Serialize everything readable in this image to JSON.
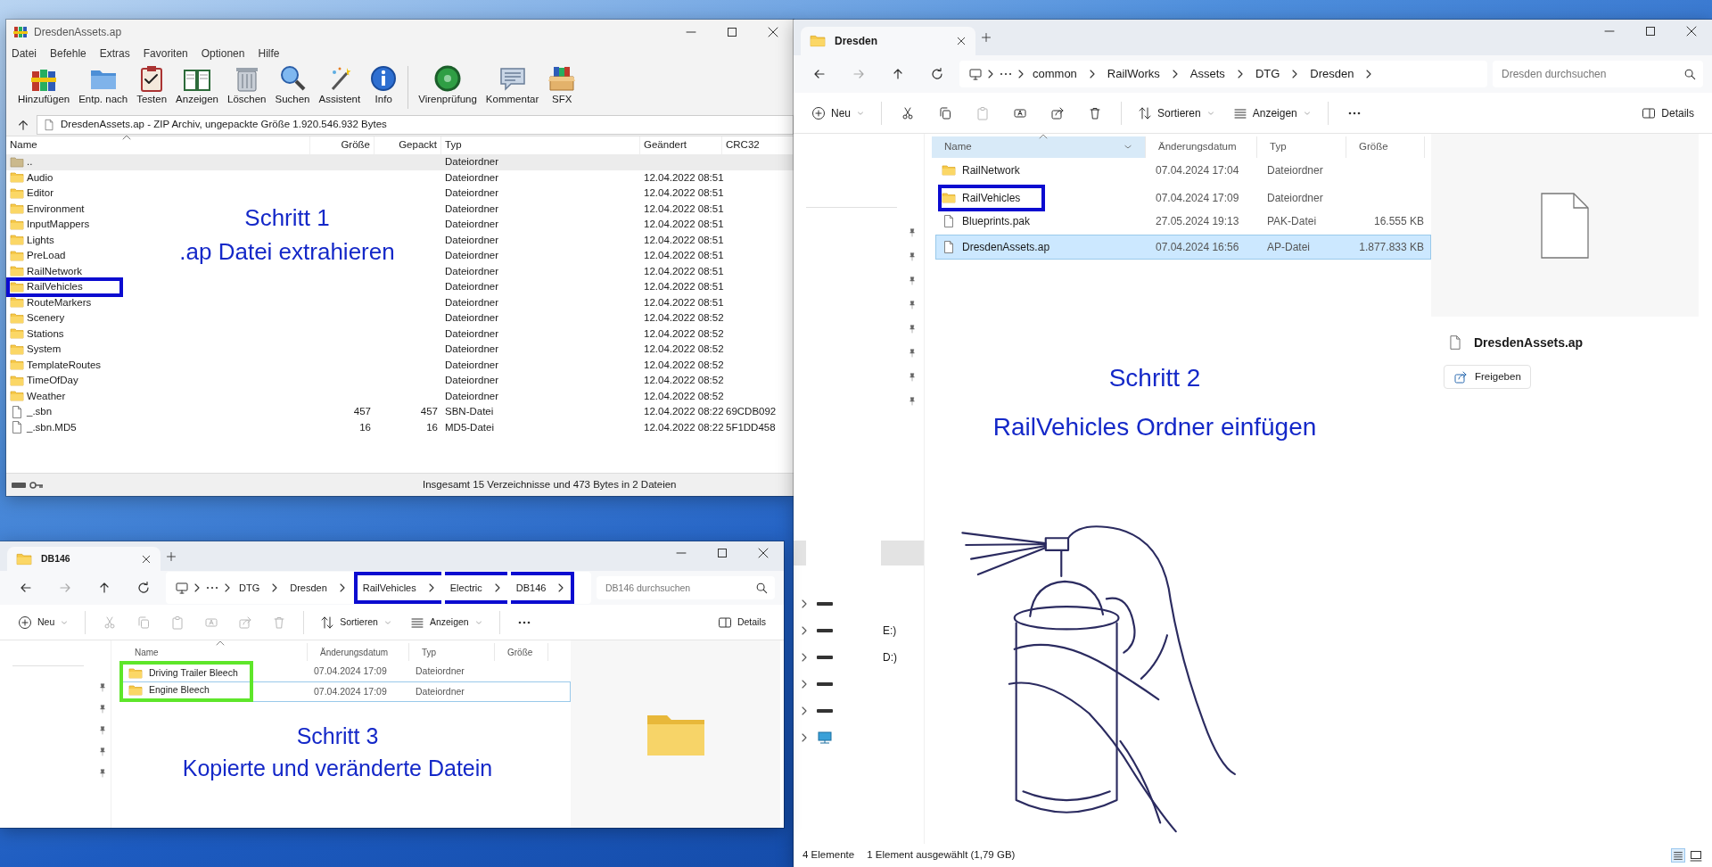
{
  "winrar": {
    "title": "DresdenAssets.ap",
    "menu": [
      "Datei",
      "Befehle",
      "Extras",
      "Favoriten",
      "Optionen",
      "Hilfe"
    ],
    "toolbar": [
      [
        {
          "label": "Hinzufügen",
          "kind": "books"
        },
        {
          "label": "Entp. nach",
          "kind": "folder"
        },
        {
          "label": "Testen",
          "kind": "clipboard"
        },
        {
          "label": "Anzeigen",
          "kind": "book"
        },
        {
          "label": "Löschen",
          "kind": "trash"
        },
        {
          "label": "Suchen",
          "kind": "magnifier"
        },
        {
          "label": "Assistent",
          "kind": "wand"
        },
        {
          "label": "Info",
          "kind": "info"
        }
      ],
      [
        {
          "label": "Virenprüfung",
          "kind": "virus"
        },
        {
          "label": "Kommentar",
          "kind": "comment"
        },
        {
          "label": "SFX",
          "kind": "box"
        }
      ]
    ],
    "path": "DresdenAssets.ap - ZIP Archiv, ungepackte Größe 1.920.546.932 Bytes",
    "columns": [
      "Name",
      "Größe",
      "Gepackt",
      "Typ",
      "Geändert",
      "CRC32"
    ],
    "rows": [
      {
        "kind": "parent",
        "name": "..",
        "type": "Dateiordner",
        "selected": true,
        "highlighted": false
      },
      {
        "kind": "folder",
        "name": "Audio",
        "type": "Dateiordner",
        "modified": "12.04.2022 08:51",
        "selected": false,
        "highlighted": false
      },
      {
        "kind": "folder",
        "name": "Editor",
        "type": "Dateiordner",
        "modified": "12.04.2022 08:51",
        "selected": false,
        "highlighted": false
      },
      {
        "kind": "folder",
        "name": "Environment",
        "type": "Dateiordner",
        "modified": "12.04.2022 08:51",
        "selected": false,
        "highlighted": false
      },
      {
        "kind": "folder",
        "name": "InputMappers",
        "type": "Dateiordner",
        "modified": "12.04.2022 08:51",
        "selected": false,
        "highlighted": false
      },
      {
        "kind": "folder",
        "name": "Lights",
        "type": "Dateiordner",
        "modified": "12.04.2022 08:51",
        "selected": false,
        "highlighted": false
      },
      {
        "kind": "folder",
        "name": "PreLoad",
        "type": "Dateiordner",
        "modified": "12.04.2022 08:51",
        "selected": false,
        "highlighted": false
      },
      {
        "kind": "folder",
        "name": "RailNetwork",
        "type": "Dateiordner",
        "modified": "12.04.2022 08:51",
        "selected": false,
        "highlighted": false
      },
      {
        "kind": "folder",
        "name": "RailVehicles",
        "type": "Dateiordner",
        "modified": "12.04.2022 08:51",
        "selected": false,
        "highlighted": true
      },
      {
        "kind": "folder",
        "name": "RouteMarkers",
        "type": "Dateiordner",
        "modified": "12.04.2022 08:51",
        "selected": false,
        "highlighted": false
      },
      {
        "kind": "folder",
        "name": "Scenery",
        "type": "Dateiordner",
        "modified": "12.04.2022 08:52",
        "selected": false,
        "highlighted": false
      },
      {
        "kind": "folder",
        "name": "Stations",
        "type": "Dateiordner",
        "modified": "12.04.2022 08:52",
        "selected": false,
        "highlighted": false
      },
      {
        "kind": "folder",
        "name": "System",
        "type": "Dateiordner",
        "modified": "12.04.2022 08:52",
        "selected": false,
        "highlighted": false
      },
      {
        "kind": "folder",
        "name": "TemplateRoutes",
        "type": "Dateiordner",
        "modified": "12.04.2022 08:52",
        "selected": false,
        "highlighted": false
      },
      {
        "kind": "folder",
        "name": "TimeOfDay",
        "type": "Dateiordner",
        "modified": "12.04.2022 08:52",
        "selected": false,
        "highlighted": false
      },
      {
        "kind": "folder",
        "name": "Weather",
        "type": "Dateiordner",
        "modified": "12.04.2022 08:52",
        "selected": false,
        "highlighted": false
      },
      {
        "kind": "file",
        "name": "_.sbn",
        "size": "457",
        "packed": "457",
        "type": "SBN-Datei",
        "modified": "12.04.2022 08:22",
        "crc": "69CDB092",
        "selected": false,
        "highlighted": false
      },
      {
        "kind": "file",
        "name": "_.sbn.MD5",
        "size": "16",
        "packed": "16",
        "type": "MD5-Datei",
        "modified": "12.04.2022 08:22",
        "crc": "5F1DD458",
        "selected": false,
        "highlighted": false
      }
    ],
    "status": "Insgesamt 15 Verzeichnisse und 473 Bytes in 2 Dateien",
    "annotation": [
      "Schritt 1",
      ".ap Datei extrahieren"
    ]
  },
  "explorer_dresden": {
    "tab": "Dresden",
    "breadcrumb": [
      {
        "label": "common",
        "highlighted": false
      },
      {
        "label": "RailWorks",
        "highlighted": false
      },
      {
        "label": "Assets",
        "highlighted": false
      },
      {
        "label": "DTG",
        "highlighted": false
      },
      {
        "label": "Dresden",
        "highlighted": false
      }
    ],
    "search_placeholder": "Dresden durchsuchen",
    "commands": [
      [
        {
          "kind": "new",
          "label": "Neu",
          "disabled": false
        }
      ],
      [
        {
          "kind": "cut",
          "disabled": false
        },
        {
          "kind": "copy",
          "disabled": false
        },
        {
          "kind": "paste",
          "disabled": true
        },
        {
          "kind": "rename",
          "disabled": false
        },
        {
          "kind": "share",
          "disabled": false
        },
        {
          "kind": "delete",
          "disabled": false
        }
      ],
      [
        {
          "kind": "sort",
          "label": "Sortieren",
          "disabled": false
        },
        {
          "kind": "view",
          "label": "Anzeigen",
          "disabled": false
        }
      ],
      [
        {
          "kind": "more",
          "disabled": false
        }
      ]
    ],
    "details_label": "Details",
    "columns": [
      {
        "label": "Name",
        "hovered": true
      },
      {
        "label": "Änderungsdatum",
        "hovered": false
      },
      {
        "label": "Typ",
        "hovered": false
      },
      {
        "label": "Größe",
        "hovered": false
      }
    ],
    "rows": [
      {
        "kind": "folder",
        "name": "RailNetwork",
        "date": "07.04.2024 17:04",
        "type": "Dateiordner",
        "selected": false,
        "focused": false,
        "highlighted": false
      },
      {
        "kind": "folder",
        "name": "RailVehicles",
        "date": "07.04.2024 17:09",
        "type": "Dateiordner",
        "selected": false,
        "focused": false,
        "highlighted": true
      },
      {
        "kind": "file",
        "name": "Blueprints.pak",
        "date": "27.05.2024 19:13",
        "type": "PAK-Datei",
        "size": "16.555 KB",
        "selected": false,
        "focused": false,
        "highlighted": false
      },
      {
        "kind": "file",
        "name": "DresdenAssets.ap",
        "date": "07.04.2024 16:56",
        "type": "AP-Datei",
        "size": "1.877.833 KB",
        "selected": true,
        "focused": true,
        "highlighted": false
      }
    ],
    "annotation": {
      "kind": "illustrated",
      "lines": [
        "Schritt 2",
        "RailVehicles Ordner einfügen"
      ]
    },
    "preview": {
      "kind": "file",
      "title": "DresdenAssets.ap",
      "share_label": "Freigeben"
    },
    "nav_drives": [
      {
        "kind": "drive"
      },
      {
        "kind": "drive",
        "label": "E:)"
      },
      {
        "kind": "drive",
        "label": "D:)"
      },
      {
        "kind": "drive"
      },
      {
        "kind": "drive"
      },
      {
        "kind": "network"
      }
    ],
    "status": [
      "4 Elemente",
      "1 Element ausgewählt (1,79 GB)"
    ]
  },
  "explorer_db146": {
    "tab": "DB146",
    "breadcrumb": [
      {
        "label": "DTG",
        "highlighted": false
      },
      {
        "label": "Dresden",
        "highlighted": false
      },
      {
        "label": "RailVehicles",
        "highlighted": true
      },
      {
        "label": "Electric",
        "highlighted": true
      },
      {
        "label": "DB146",
        "highlighted": true
      }
    ],
    "search_placeholder": "DB146 durchsuchen",
    "commands": [
      [
        {
          "kind": "new",
          "label": "Neu",
          "disabled": false
        }
      ],
      [
        {
          "kind": "cut",
          "disabled": true
        },
        {
          "kind": "copy",
          "disabled": true
        },
        {
          "kind": "paste",
          "disabled": true
        },
        {
          "kind": "rename",
          "disabled": true
        },
        {
          "kind": "share",
          "disabled": true
        },
        {
          "kind": "delete",
          "disabled": true
        }
      ],
      [
        {
          "kind": "sort",
          "label": "Sortieren",
          "disabled": false
        },
        {
          "kind": "view",
          "label": "Anzeigen",
          "disabled": false
        }
      ],
      [
        {
          "kind": "more",
          "disabled": false
        }
      ]
    ],
    "details_label": "Details",
    "columns": [
      {
        "label": "Name",
        "hovered": false
      },
      {
        "label": "Änderungsdatum",
        "hovered": false
      },
      {
        "label": "Typ",
        "hovered": false
      },
      {
        "label": "Größe",
        "hovered": false
      }
    ],
    "rows": [
      {
        "kind": "folder",
        "name": "Driving Trailer Bleech",
        "date": "07.04.2024 17:09",
        "type": "Dateiordner",
        "selected": false,
        "focused": false,
        "highlighted": true
      },
      {
        "kind": "folder",
        "name": "Engine Bleech",
        "date": "07.04.2024 17:09",
        "type": "Dateiordner",
        "selected": false,
        "focused": true,
        "highlighted": true
      }
    ],
    "annotation": {
      "kind": "plain",
      "lines": [
        "Schritt 3",
        "Kopierte und veränderte Datein"
      ]
    },
    "preview": {
      "kind": "folder"
    }
  }
}
